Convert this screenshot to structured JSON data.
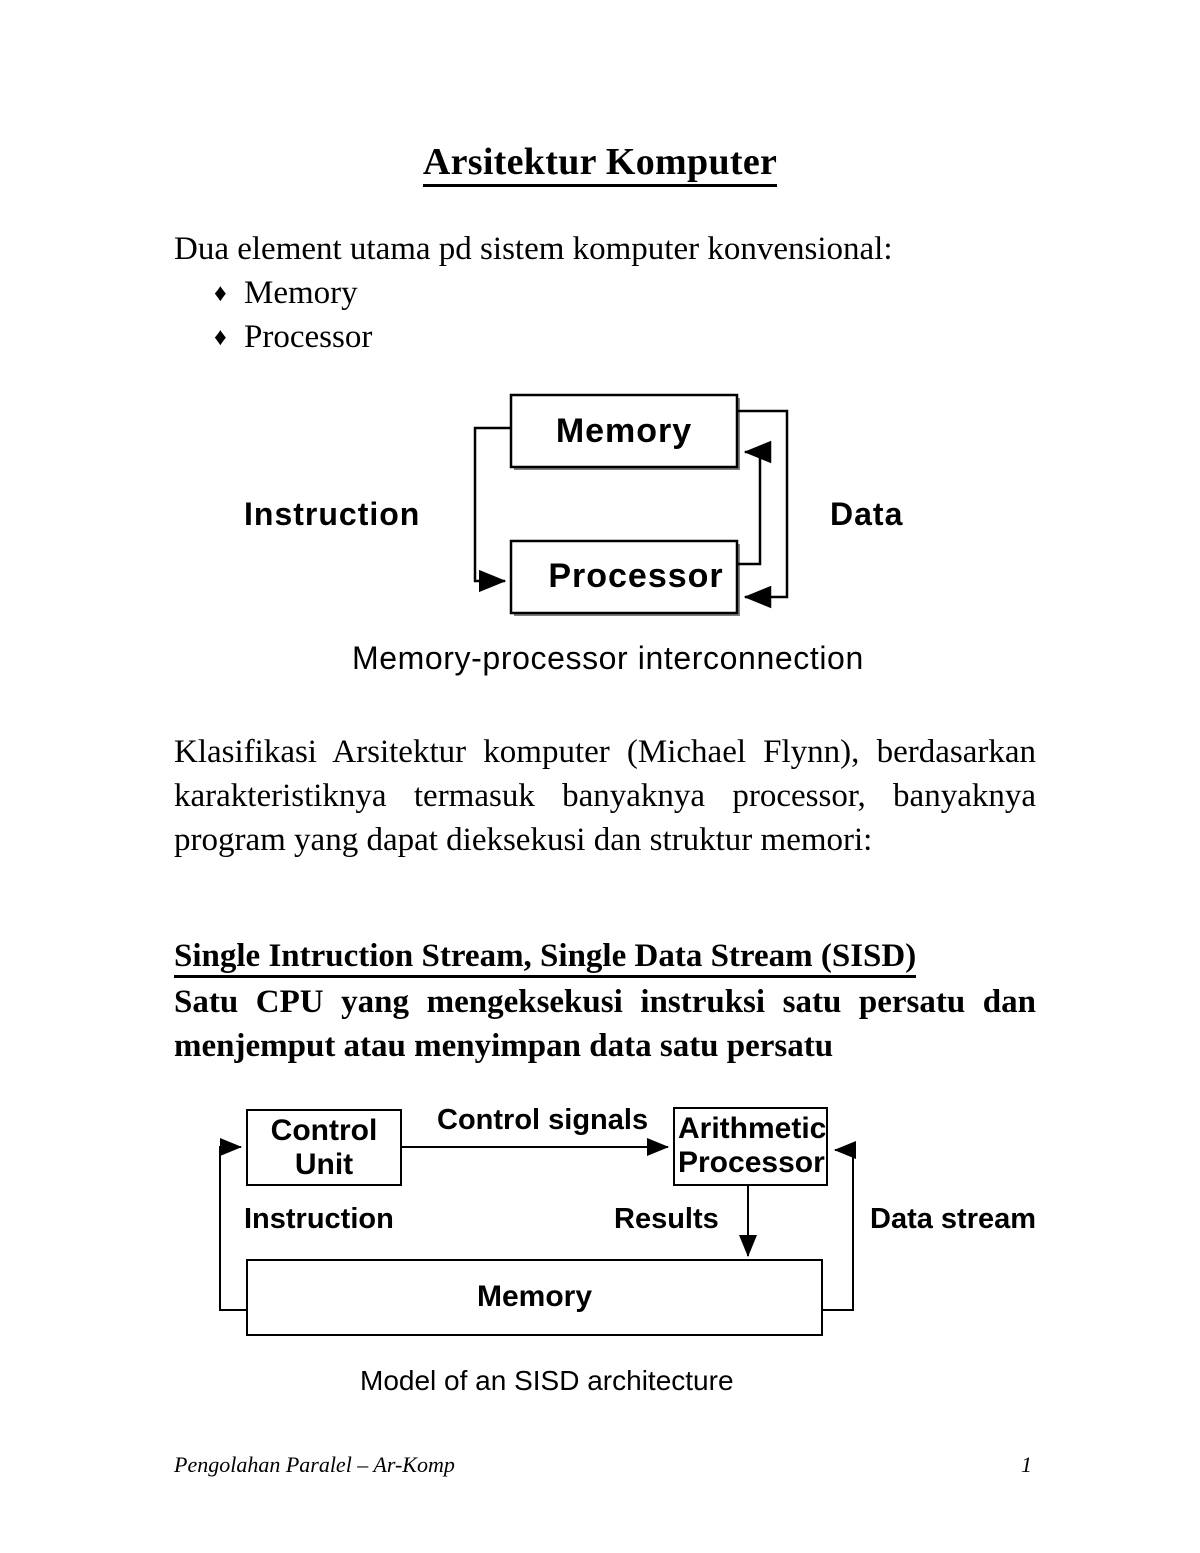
{
  "document": {
    "title": "Arsitektur Komputer",
    "intro_line": "Dua element utama pd sistem komputer konvensional:",
    "bullets": [
      {
        "marker": "♦",
        "label": "Memory"
      },
      {
        "marker": "♦",
        "label": "Processor"
      }
    ],
    "flynn_paragraph": "Klasifikasi Arsitektur komputer (Michael Flynn), berdasarkan karakteristiknya termasuk banyaknya processor, banyaknya program yang dapat dieksekusi dan struktur memori:",
    "sisd_heading": "Single Intruction Stream, Single Data Stream (SISD)",
    "sisd_description": "Satu CPU yang mengeksekusi instruksi satu persatu dan menjemput atau menyimpan data satu persatu"
  },
  "diagram_memory_processor": {
    "caption": "Memory-processor interconnection",
    "boxes": [
      {
        "name": "memory",
        "label": "Memory"
      },
      {
        "name": "processor",
        "label": "Processor"
      }
    ],
    "edge_labels": [
      {
        "name": "instruction",
        "label": "Instruction"
      },
      {
        "name": "data",
        "label": "Data"
      }
    ]
  },
  "diagram_sisd": {
    "caption": "Model of an SISD architecture",
    "boxes": [
      {
        "name": "control-unit",
        "label_line1": "Control",
        "label_line2": "Unit"
      },
      {
        "name": "arithmetic-processor",
        "label_line1": "Arithmetic",
        "label_line2": "Processor"
      },
      {
        "name": "memory",
        "label": "Memory"
      }
    ],
    "edge_labels": [
      {
        "name": "control-signals",
        "label": "Control signals"
      },
      {
        "name": "instruction",
        "label": "Instruction"
      },
      {
        "name": "results",
        "label": "Results"
      },
      {
        "name": "data-stream",
        "label": "Data stream"
      }
    ]
  },
  "footer": {
    "left": "Pengolahan Paralel – Ar-Komp",
    "page_number": "1"
  },
  "colors": {
    "text": "#000000",
    "background": "#ffffff",
    "stroke": "#000000",
    "box_shadow_edge": "#808080"
  }
}
